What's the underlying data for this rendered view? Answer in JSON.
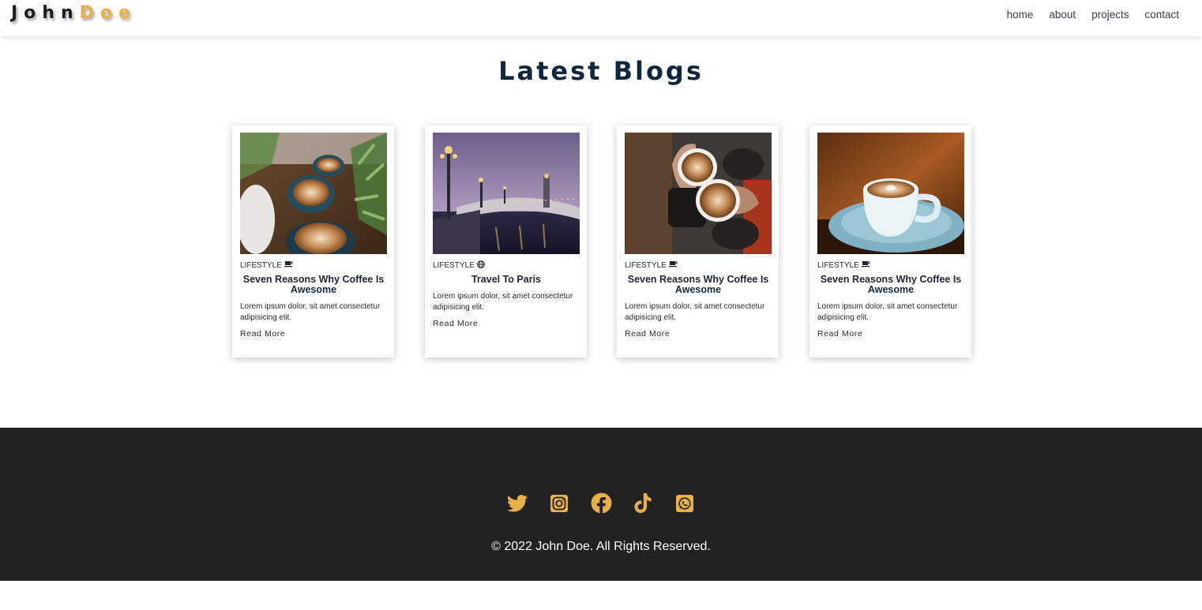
{
  "header": {
    "logo_first": "John",
    "logo_last": "Doe",
    "nav": [
      "home",
      "about",
      "projects",
      "contact"
    ]
  },
  "blogs": {
    "title": "Latest Blogs",
    "cards": [
      {
        "category": "LIFESTYLE",
        "category_icon": "coffee-icon",
        "title": "Seven Reasons Why Coffee Is Awesome",
        "text": "Lorem ipsum dolor, sit amet consectetur adipisicing elit.",
        "link": "Read More",
        "image": "coffee-latte-plants-photo"
      },
      {
        "category": "LIFESTYLE",
        "category_icon": "globe-icon",
        "title": "Travel To Paris",
        "text": "Lorem ipsum dolor, sit amet consectetur adipisicing elit.",
        "link": "Read More",
        "image": "paris-bridge-dusk-photo"
      },
      {
        "category": "LIFESTYLE",
        "category_icon": "coffee-icon",
        "title": "Seven Reasons Why Coffee Is Awesome",
        "text": "Lorem ipsum dolor, sit amet consectetur adipisicing elit.",
        "link": "Read More",
        "image": "coffee-cheers-photo"
      },
      {
        "category": "LIFESTYLE",
        "category_icon": "coffee-icon",
        "title": "Seven Reasons Why Coffee Is Awesome",
        "text": "Lorem ipsum dolor, sit amet consectetur adipisicing elit.",
        "link": "Read More",
        "image": "blue-cup-latte-photo"
      }
    ]
  },
  "footer": {
    "socials": [
      "twitter-icon",
      "instagram-icon",
      "facebook-icon",
      "tiktok-icon",
      "whatsapp-icon"
    ],
    "copyright": "© 2022 John Doe. All Rights Reserved."
  },
  "colors": {
    "accent": "#e8b04a",
    "title": "#10273d",
    "footer_bg": "#222222"
  }
}
